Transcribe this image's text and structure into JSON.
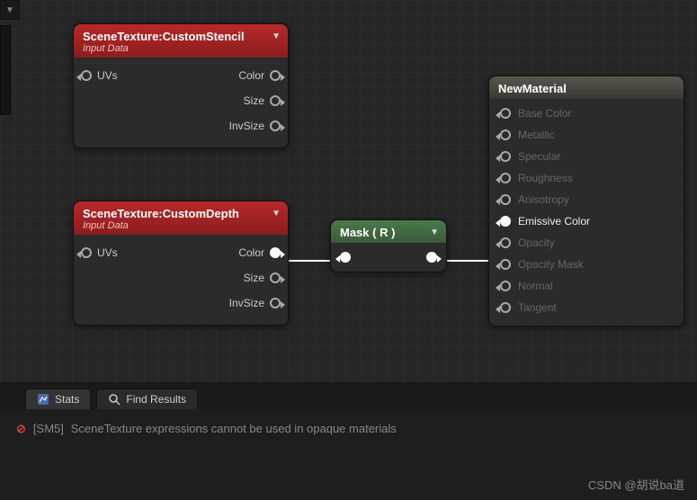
{
  "nodes": {
    "stencil": {
      "title": "SceneTexture:CustomStencil",
      "subtitle": "Input Data",
      "inputs": {
        "uvs": "UVs"
      },
      "outputs": {
        "color": "Color",
        "size": "Size",
        "invsize": "InvSize"
      }
    },
    "depth": {
      "title": "SceneTexture:CustomDepth",
      "subtitle": "Input Data",
      "inputs": {
        "uvs": "UVs"
      },
      "outputs": {
        "color": "Color",
        "size": "Size",
        "invsize": "InvSize"
      }
    },
    "mask": {
      "title": "Mask ( R )"
    },
    "result": {
      "title": "NewMaterial",
      "pins": [
        {
          "label": "Base Color",
          "active": false
        },
        {
          "label": "Metallic",
          "active": false
        },
        {
          "label": "Specular",
          "active": false
        },
        {
          "label": "Roughness",
          "active": false
        },
        {
          "label": "Anisotropy",
          "active": false
        },
        {
          "label": "Emissive Color",
          "active": true
        },
        {
          "label": "Opacity",
          "active": false
        },
        {
          "label": "Opacity Mask",
          "active": false
        },
        {
          "label": "Normal",
          "active": false
        },
        {
          "label": "Tangent",
          "active": false
        }
      ]
    }
  },
  "tabs": {
    "stats": "Stats",
    "find": "Find Results"
  },
  "error": {
    "prefix": "[SM5]",
    "message": "SceneTexture expressions cannot be used in opaque materials"
  },
  "watermark": "CSDN @胡说ba道"
}
